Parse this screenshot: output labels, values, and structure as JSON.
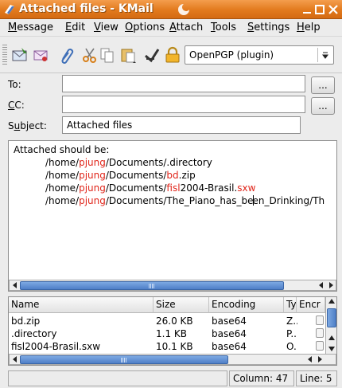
{
  "window": {
    "title": "Attached files - KMail",
    "icons": {
      "app": "kmail-icon",
      "deco": "crescent-icon",
      "minimize": "minimize-icon",
      "maximize": "maximize-icon",
      "close": "close-icon"
    }
  },
  "menu": [
    {
      "label": "Message",
      "accel": "M",
      "rest": "essage"
    },
    {
      "label": "Edit",
      "accel": "E",
      "rest": "dit"
    },
    {
      "label": "View",
      "accel": "V",
      "rest": "iew"
    },
    {
      "label": "Options",
      "accel": "O",
      "rest": "ptions"
    },
    {
      "label": "Attach",
      "accel": "A",
      "rest": "ttach"
    },
    {
      "label": "Tools",
      "accel": "T",
      "rest": "ools"
    },
    {
      "label": "Settings",
      "accel": "S",
      "rest": "ettings"
    },
    {
      "label": "Help",
      "accel": "H",
      "rest": "elp"
    }
  ],
  "toolbar": {
    "icons": [
      "send-icon",
      "sign-icon",
      "attach-paperclip-icon",
      "cut-icon",
      "copy-icon",
      "paste-icon",
      "spellcheck-icon",
      "encrypt-lock-icon"
    ],
    "crypto_module": "OpenPGP (plugin)"
  },
  "header": {
    "to": {
      "accel": "T",
      "rest": "o:",
      "value": "",
      "button": "..."
    },
    "cc": {
      "accel": "C",
      "rest": "C:",
      "value": "",
      "button": "..."
    },
    "subject": {
      "pre": "S",
      "accel": "u",
      "rest": "bject:",
      "value": "Attached files"
    }
  },
  "body": {
    "intro": "Attached should be:",
    "paths": [
      {
        "a": "/home/",
        "user": "pjung",
        "b": "/Documents/.directory",
        "c": "",
        "d": ""
      },
      {
        "a": "/home/",
        "user": "pjung",
        "b": "/Documents/",
        "c": "bd",
        "d": ".zip"
      },
      {
        "a": "/home/",
        "user": "pjung",
        "b": "/Documents/",
        "c": "fisl",
        "d": "2004-Brasil.",
        "e": "sxw"
      },
      {
        "a": "/home/",
        "user": "pjung",
        "b": "/Documents/The_Piano_has_be",
        "c2": "en_Drinking/Th"
      }
    ]
  },
  "attachments": {
    "columns": [
      "Name",
      "Size",
      "Encoding",
      "Ty",
      "Encr"
    ],
    "rows": [
      {
        "name": "bd.zip",
        "size": "26.0 KB",
        "encoding": "base64",
        "type": "Z.."
      },
      {
        "name": ".directory",
        "size": "1.1 KB",
        "encoding": "base64",
        "type": "P.."
      },
      {
        "name": "fisl2004-Brasil.sxw",
        "size": "10.1 KB",
        "encoding": "base64",
        "type": "O."
      }
    ]
  },
  "status": {
    "column": "Column: 47",
    "line": "Line: 5"
  }
}
